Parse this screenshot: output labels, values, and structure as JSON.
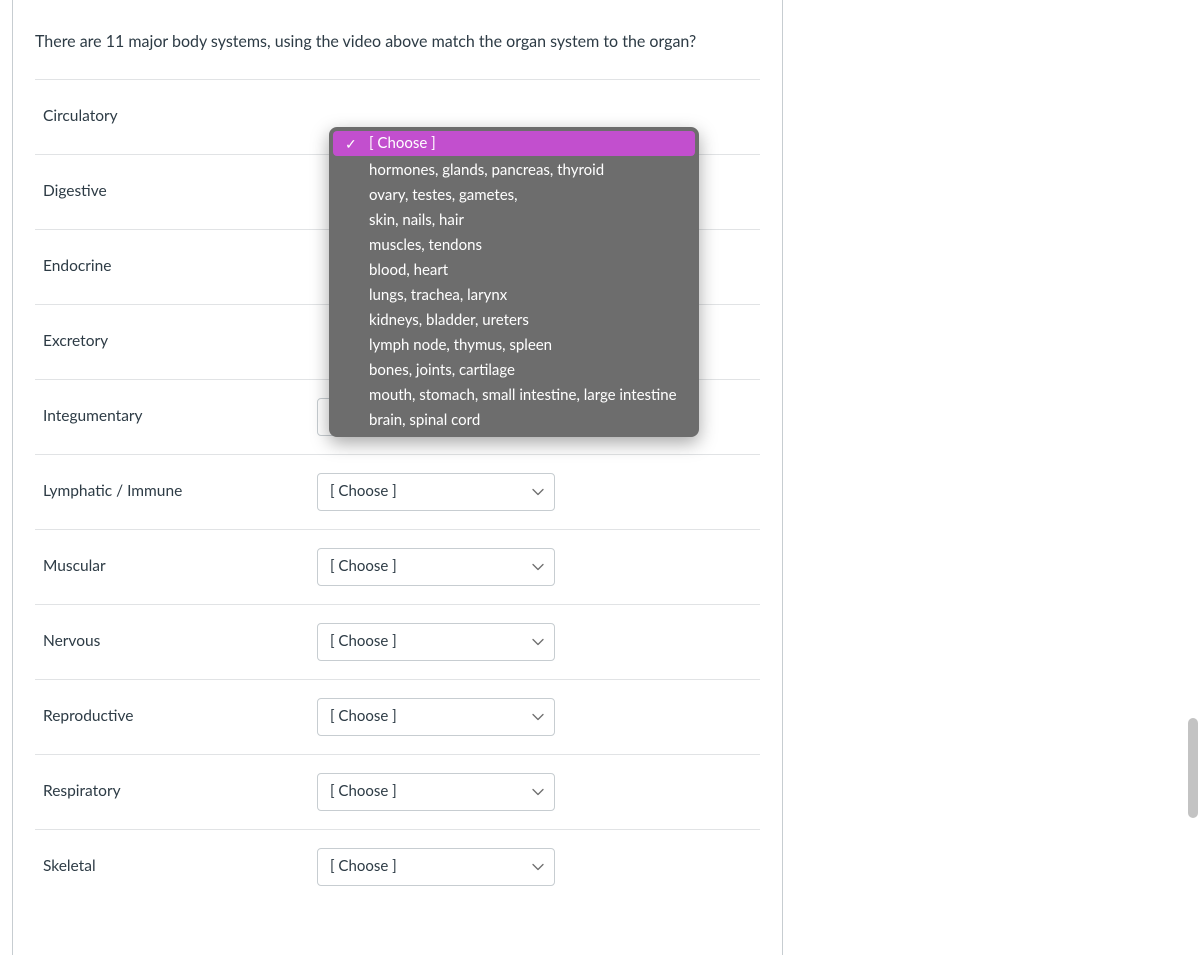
{
  "question": {
    "text": "There are 11 major body systems, using the video above match the organ system to the organ?"
  },
  "choose_placeholder": "[ Choose ]",
  "rows": [
    {
      "label": "Circulatory"
    },
    {
      "label": "Digestive"
    },
    {
      "label": "Endocrine"
    },
    {
      "label": "Excretory"
    },
    {
      "label": "Integumentary"
    },
    {
      "label": "Lymphatic / Immune"
    },
    {
      "label": "Muscular"
    },
    {
      "label": "Nervous"
    },
    {
      "label": "Reproductive"
    },
    {
      "label": "Respiratory"
    },
    {
      "label": "Skeletal"
    }
  ],
  "dropdown": {
    "selected": "[ Choose ]",
    "options": [
      "hormones, glands, pancreas, thyroid",
      "ovary, testes, gametes,",
      "skin, nails, hair",
      "muscles, tendons",
      "blood, heart",
      "lungs, trachea, larynx",
      "kidneys, bladder, ureters",
      "lymph node, thymus, spleen",
      "bones, joints, cartilage",
      "mouth, stomach, small intestine, large intestine",
      "brain, spinal cord"
    ]
  }
}
